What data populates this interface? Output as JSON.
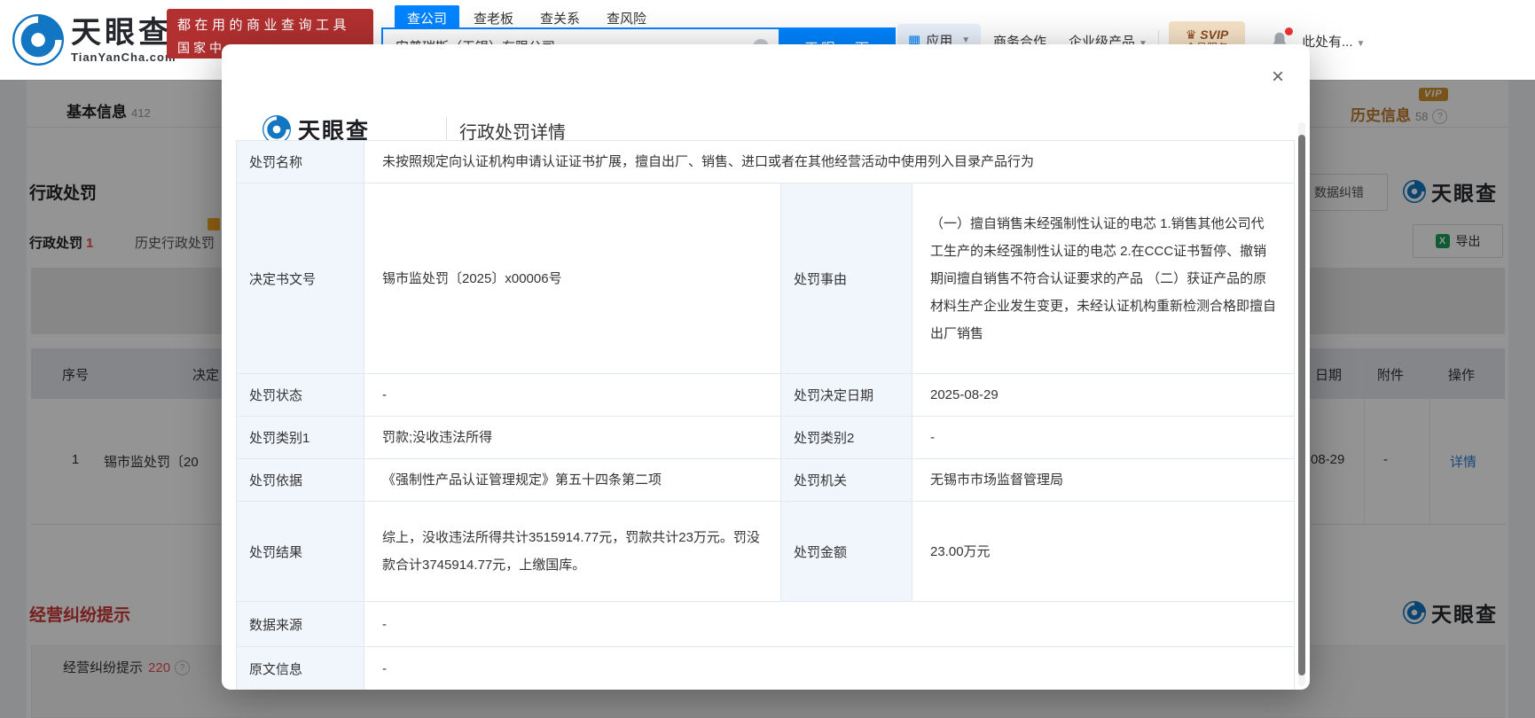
{
  "colors": {
    "accent_blue": "#0084ff",
    "brand_red": "#b23030",
    "link_blue": "#2e7ed8",
    "count_red": "#f04b4b",
    "vip_orange": "#bf7b2c",
    "label_cell_blue": "#f0f6fc"
  },
  "header": {
    "logo": {
      "name": "天眼查",
      "domain": "TianYanCha.com"
    },
    "banner": {
      "line1": "都在用的商业查询工具",
      "line2": "国家中"
    },
    "search_tabs": {
      "company": "查公司",
      "boss": "查老板",
      "relation": "查关系",
      "risk": "查风险"
    },
    "search": {
      "value": "安普瑞斯（无锡）有限公司",
      "button": "天眼一下",
      "clear": "×"
    },
    "nav": {
      "apps": "应用",
      "cooperation": "商务合作",
      "enterprise": "企业级产品",
      "svip_line1": "SVIP",
      "svip_line2": "会员服务",
      "user": "此处有..."
    }
  },
  "page": {
    "tabs_bar": {
      "basic_label": "基本信息",
      "basic_count": "412",
      "history_label": "历史信息",
      "history_count": "58",
      "vip_badge": "VIP",
      "help": "?"
    },
    "section_title": "行政处罚",
    "tabs": {
      "current": "行政处罚",
      "current_count": "1",
      "history": "历史行政处罚"
    },
    "data_correction": "数据纠错",
    "export": "导出",
    "watermark": "天眼查",
    "table": {
      "headers": {
        "index": "序号",
        "doc_no": "决定",
        "date": "日期",
        "attachment": "附件",
        "action": "操作"
      },
      "row": {
        "index": "1",
        "doc_no": "锡市监处罚〔20",
        "date": "08-29",
        "attachment": "-",
        "action": "详情"
      }
    },
    "dispute": {
      "title": "经营纠纷提示",
      "item_label": "经营纠纷提示",
      "item_count": "220",
      "help": "?"
    }
  },
  "modal": {
    "logo": "天眼查",
    "title": "行政处罚详情",
    "close": "×",
    "fields": {
      "penalty_name": {
        "label": "处罚名称",
        "value": "未按照规定向认证机构申请认证证书扩展，擅自出厂、销售、进口或者在其他经营活动中使用列入目录产品行为"
      },
      "doc_no": {
        "label": "决定书文号",
        "value": "锡市监处罚〔2025〕x00006号"
      },
      "reason": {
        "label": "处罚事由",
        "value": "（一）擅自销售未经强制性认证的电芯 1.销售其他公司代工生产的未经强制性认证的电芯 2.在CCC证书暂停、撤销期间擅自销售不符合认证要求的产品 （二）获证产品的原材料生产企业发生变更，未经认证机构重新检测合格即擅自出厂销售"
      },
      "status": {
        "label": "处罚状态",
        "value": "-"
      },
      "decision_date": {
        "label": "处罚决定日期",
        "value": "2025-08-29"
      },
      "category1": {
        "label": "处罚类别1",
        "value": "罚款;没收违法所得"
      },
      "category2": {
        "label": "处罚类别2",
        "value": "-"
      },
      "basis": {
        "label": "处罚依据",
        "value": "《强制性产品认证管理规定》第五十四条第二项"
      },
      "authority": {
        "label": "处罚机关",
        "value": "无锡市市场监督管理局"
      },
      "result": {
        "label": "处罚结果",
        "value": "综上，没收违法所得共计3515914.77元，罚款共计23万元。罚没款合计3745914.77元，上缴国库。"
      },
      "amount": {
        "label": "处罚金额",
        "value": "23.00万元"
      },
      "data_source": {
        "label": "数据来源",
        "value": "-"
      },
      "original_info": {
        "label": "原文信息",
        "value": "-"
      }
    }
  }
}
